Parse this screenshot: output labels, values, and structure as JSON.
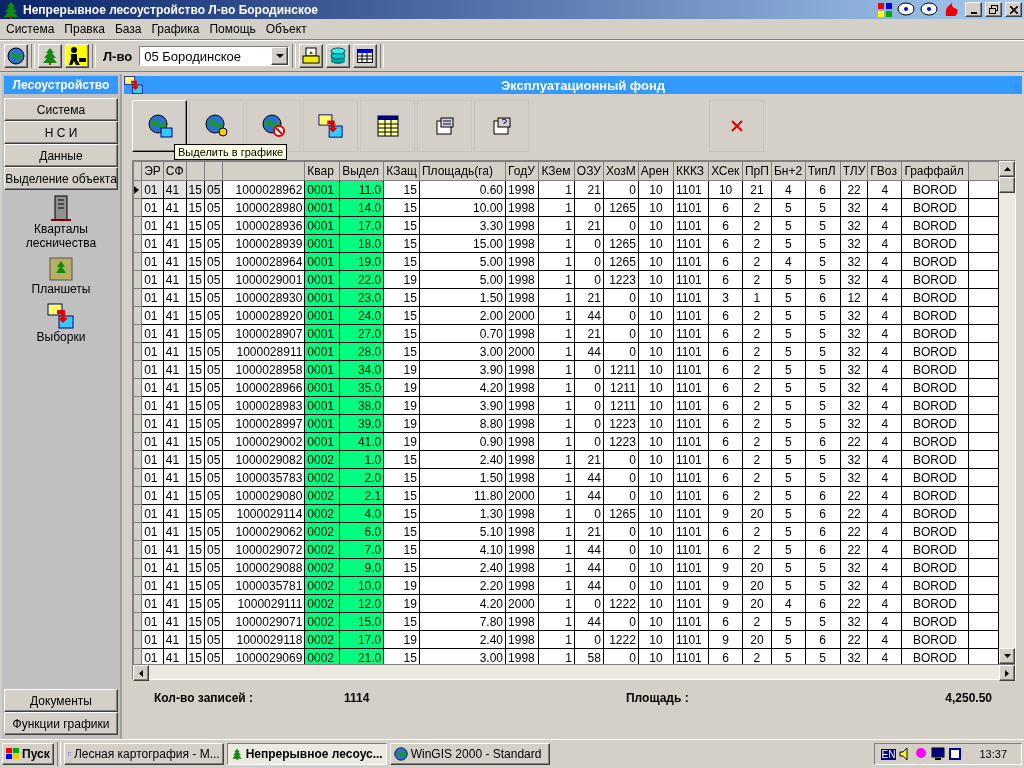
{
  "window": {
    "title": "Непрерывное лесоустройство  Л-во Бородинское"
  },
  "menu": [
    "Система",
    "Правка",
    "База",
    "Графика",
    "Помощь",
    "Объект"
  ],
  "toolbar": {
    "label": "Л-во",
    "select_value": "05 Бородинское"
  },
  "sidebar": {
    "title": "Лесоустройство",
    "buttons": [
      "Система",
      "Н С И",
      "Данные",
      "Выделение объекта"
    ],
    "items": [
      {
        "kind": "tower",
        "label": "Кварталы лесничества"
      },
      {
        "kind": "map",
        "label": "Планшеты"
      },
      {
        "kind": "tables",
        "label": "Выборки"
      }
    ],
    "bottom_buttons": [
      "Документы",
      "Функции графики"
    ]
  },
  "panel": {
    "title": "Эксплуатационный фонд",
    "tools": [
      {
        "kind": "globe-table",
        "pressed": true
      },
      {
        "kind": "globe-pin",
        "pressed": false
      },
      {
        "kind": "globe-ban",
        "pressed": false
      },
      {
        "kind": "tables",
        "pressed": false
      },
      {
        "kind": "grid",
        "pressed": false
      },
      {
        "kind": "form",
        "pressed": false
      },
      {
        "kind": "form-help",
        "pressed": false
      },
      {
        "kind": "close",
        "pressed": false
      }
    ],
    "tooltip": "Выделить в графике",
    "table": {
      "columns": [
        {
          "label": "ЭР",
          "highlighted": false
        },
        {
          "label": "СФ",
          "highlighted": false
        },
        {
          "highlighted": false
        },
        {
          "highlighted": false
        },
        {
          "highlighted": false
        },
        {
          "label": "Квар",
          "highlighted": true
        },
        {
          "label": "Выдел",
          "highlighted": true
        },
        {
          "label": "КЗащ",
          "highlighted": false
        },
        {
          "label": "Площадь(га)",
          "highlighted": false
        },
        {
          "label": "ГодУ",
          "highlighted": false
        },
        {
          "label": "КЗем",
          "highlighted": false
        },
        {
          "label": "ОЗУ",
          "highlighted": false
        },
        {
          "label": "ХозМ",
          "highlighted": false
        },
        {
          "label": "Арен",
          "highlighted": false
        },
        {
          "label": "КККЗ",
          "highlighted": false
        },
        {
          "label": "ХСек",
          "highlighted": false
        },
        {
          "label": "ПрП",
          "highlighted": false
        },
        {
          "label": "Бн+2",
          "highlighted": false
        },
        {
          "label": "ТипЛ",
          "highlighted": false
        },
        {
          "label": "ТЛУ",
          "highlighted": false
        },
        {
          "label": "ГВоз",
          "highlighted": false
        },
        {
          "label": "Граффайл",
          "highlighted": false
        }
      ],
      "rows": [
        {
          "selected": true,
          "cells": [
            "01",
            "41",
            "15",
            "05",
            "1000028962",
            "0001",
            "11.0",
            "15",
            "0.60",
            "1998",
            "1",
            "21",
            "0",
            "10",
            "1101",
            "10",
            "21",
            "4",
            "6",
            "22",
            "4",
            "BOROD"
          ]
        },
        {
          "selected": false,
          "cells": [
            "01",
            "41",
            "15",
            "05",
            "1000028980",
            "0001",
            "14.0",
            "15",
            "10.00",
            "1998",
            "1",
            "0",
            "1265",
            "10",
            "1101",
            "6",
            "2",
            "5",
            "5",
            "32",
            "4",
            "BOROD"
          ]
        },
        {
          "selected": false,
          "cells": [
            "01",
            "41",
            "15",
            "05",
            "1000028936",
            "0001",
            "17.0",
            "15",
            "3.30",
            "1998",
            "1",
            "21",
            "0",
            "10",
            "1101",
            "6",
            "2",
            "5",
            "5",
            "32",
            "4",
            "BOROD"
          ]
        },
        {
          "selected": false,
          "cells": [
            "01",
            "41",
            "15",
            "05",
            "1000028939",
            "0001",
            "18.0",
            "15",
            "15.00",
            "1998",
            "1",
            "0",
            "1265",
            "10",
            "1101",
            "6",
            "2",
            "5",
            "5",
            "32",
            "4",
            "BOROD"
          ]
        },
        {
          "selected": false,
          "cells": [
            "01",
            "41",
            "15",
            "05",
            "1000028964",
            "0001",
            "19.0",
            "15",
            "5.00",
            "1998",
            "1",
            "0",
            "1265",
            "10",
            "1101",
            "6",
            "2",
            "4",
            "5",
            "32",
            "4",
            "BOROD"
          ]
        },
        {
          "selected": false,
          "cells": [
            "01",
            "41",
            "15",
            "05",
            "1000029001",
            "0001",
            "22.0",
            "19",
            "5.00",
            "1998",
            "1",
            "0",
            "1223",
            "10",
            "1101",
            "6",
            "2",
            "5",
            "5",
            "32",
            "4",
            "BOROD"
          ]
        },
        {
          "selected": false,
          "cells": [
            "01",
            "41",
            "15",
            "05",
            "1000028930",
            "0001",
            "23.0",
            "15",
            "1.50",
            "1998",
            "1",
            "21",
            "0",
            "10",
            "1101",
            "3",
            "1",
            "5",
            "6",
            "12",
            "4",
            "BOROD"
          ]
        },
        {
          "selected": false,
          "cells": [
            "01",
            "41",
            "15",
            "05",
            "1000028920",
            "0001",
            "24.0",
            "15",
            "2.00",
            "2000",
            "1",
            "44",
            "0",
            "10",
            "1101",
            "6",
            "2",
            "5",
            "5",
            "32",
            "4",
            "BOROD"
          ]
        },
        {
          "selected": false,
          "cells": [
            "01",
            "41",
            "15",
            "05",
            "1000028907",
            "0001",
            "27.0",
            "15",
            "0.70",
            "1998",
            "1",
            "21",
            "0",
            "10",
            "1101",
            "6",
            "2",
            "5",
            "5",
            "32",
            "4",
            "BOROD"
          ]
        },
        {
          "selected": false,
          "cells": [
            "01",
            "41",
            "15",
            "05",
            "1000028911",
            "0001",
            "28.0",
            "15",
            "3.00",
            "2000",
            "1",
            "44",
            "0",
            "10",
            "1101",
            "6",
            "2",
            "5",
            "5",
            "32",
            "4",
            "BOROD"
          ]
        },
        {
          "selected": false,
          "cells": [
            "01",
            "41",
            "15",
            "05",
            "1000028958",
            "0001",
            "34.0",
            "19",
            "3.90",
            "1998",
            "1",
            "0",
            "1211",
            "10",
            "1101",
            "6",
            "2",
            "5",
            "5",
            "32",
            "4",
            "BOROD"
          ]
        },
        {
          "selected": false,
          "cells": [
            "01",
            "41",
            "15",
            "05",
            "1000028966",
            "0001",
            "35.0",
            "19",
            "4.20",
            "1998",
            "1",
            "0",
            "1211",
            "10",
            "1101",
            "6",
            "2",
            "5",
            "5",
            "32",
            "4",
            "BOROD"
          ]
        },
        {
          "selected": false,
          "cells": [
            "01",
            "41",
            "15",
            "05",
            "1000028983",
            "0001",
            "38.0",
            "19",
            "3.90",
            "1998",
            "1",
            "0",
            "1211",
            "10",
            "1101",
            "6",
            "2",
            "5",
            "5",
            "32",
            "4",
            "BOROD"
          ]
        },
        {
          "selected": false,
          "cells": [
            "01",
            "41",
            "15",
            "05",
            "1000028997",
            "0001",
            "39.0",
            "19",
            "8.80",
            "1998",
            "1",
            "0",
            "1223",
            "10",
            "1101",
            "6",
            "2",
            "5",
            "5",
            "32",
            "4",
            "BOROD"
          ]
        },
        {
          "selected": false,
          "cells": [
            "01",
            "41",
            "15",
            "05",
            "1000029002",
            "0001",
            "41.0",
            "19",
            "0.90",
            "1998",
            "1",
            "0",
            "1223",
            "10",
            "1101",
            "6",
            "2",
            "5",
            "6",
            "22",
            "4",
            "BOROD"
          ]
        },
        {
          "selected": false,
          "cells": [
            "01",
            "41",
            "15",
            "05",
            "1000029082",
            "0002",
            "1.0",
            "15",
            "2.40",
            "1998",
            "1",
            "21",
            "0",
            "10",
            "1101",
            "6",
            "2",
            "5",
            "5",
            "32",
            "4",
            "BOROD"
          ]
        },
        {
          "selected": false,
          "cells": [
            "01",
            "41",
            "15",
            "05",
            "1000035783",
            "0002",
            "2.0",
            "15",
            "1.50",
            "1998",
            "1",
            "44",
            "0",
            "10",
            "1101",
            "6",
            "2",
            "5",
            "5",
            "32",
            "4",
            "BOROD"
          ]
        },
        {
          "selected": false,
          "cells": [
            "01",
            "41",
            "15",
            "05",
            "1000029080",
            "0002",
            "2.1",
            "15",
            "11.80",
            "2000",
            "1",
            "44",
            "0",
            "10",
            "1101",
            "6",
            "2",
            "5",
            "6",
            "22",
            "4",
            "BOROD"
          ]
        },
        {
          "selected": false,
          "cells": [
            "01",
            "41",
            "15",
            "05",
            "1000029114",
            "0002",
            "4.0",
            "15",
            "1.30",
            "1998",
            "1",
            "0",
            "1265",
            "10",
            "1101",
            "9",
            "20",
            "5",
            "6",
            "22",
            "4",
            "BOROD"
          ]
        },
        {
          "selected": false,
          "cells": [
            "01",
            "41",
            "15",
            "05",
            "1000029062",
            "0002",
            "6.0",
            "15",
            "5.10",
            "1998",
            "1",
            "21",
            "0",
            "10",
            "1101",
            "6",
            "2",
            "5",
            "6",
            "22",
            "4",
            "BOROD"
          ]
        },
        {
          "selected": false,
          "cells": [
            "01",
            "41",
            "15",
            "05",
            "1000029072",
            "0002",
            "7.0",
            "15",
            "4.10",
            "1998",
            "1",
            "44",
            "0",
            "10",
            "1101",
            "6",
            "2",
            "5",
            "6",
            "22",
            "4",
            "BOROD"
          ]
        },
        {
          "selected": false,
          "cells": [
            "01",
            "41",
            "15",
            "05",
            "1000029088",
            "0002",
            "9.0",
            "15",
            "2.40",
            "1998",
            "1",
            "44",
            "0",
            "10",
            "1101",
            "9",
            "20",
            "5",
            "5",
            "32",
            "4",
            "BOROD"
          ]
        },
        {
          "selected": false,
          "cells": [
            "01",
            "41",
            "15",
            "05",
            "1000035781",
            "0002",
            "10.0",
            "19",
            "2.20",
            "1998",
            "1",
            "44",
            "0",
            "10",
            "1101",
            "9",
            "20",
            "5",
            "5",
            "32",
            "4",
            "BOROD"
          ]
        },
        {
          "selected": false,
          "cells": [
            "01",
            "41",
            "15",
            "05",
            "1000029111",
            "0002",
            "12.0",
            "19",
            "4.20",
            "2000",
            "1",
            "0",
            "1222",
            "10",
            "1101",
            "9",
            "20",
            "4",
            "6",
            "22",
            "4",
            "BOROD"
          ]
        },
        {
          "selected": false,
          "cells": [
            "01",
            "41",
            "15",
            "05",
            "1000029071",
            "0002",
            "15.0",
            "15",
            "7.80",
            "1998",
            "1",
            "44",
            "0",
            "10",
            "1101",
            "6",
            "2",
            "5",
            "5",
            "32",
            "4",
            "BOROD"
          ]
        },
        {
          "selected": false,
          "cells": [
            "01",
            "41",
            "15",
            "05",
            "1000029118",
            "0002",
            "17.0",
            "19",
            "2.40",
            "1998",
            "1",
            "0",
            "1222",
            "10",
            "1101",
            "9",
            "20",
            "5",
            "6",
            "22",
            "4",
            "BOROD"
          ]
        },
        {
          "selected": false,
          "cells": [
            "01",
            "41",
            "15",
            "05",
            "1000029069",
            "0002",
            "21.0",
            "15",
            "3.00",
            "1998",
            "1",
            "58",
            "0",
            "10",
            "1101",
            "6",
            "2",
            "5",
            "5",
            "32",
            "4",
            "BOROD"
          ]
        }
      ]
    },
    "status": {
      "count_label": "Кол-во записей :",
      "count": "1114",
      "area_label": "Площадь :",
      "area": "4,250.50"
    }
  },
  "taskbar": {
    "start": "Пуск",
    "tasks": [
      {
        "label": "Лесная картография - М...",
        "selected": false
      },
      {
        "label": "Непрерывное лесоус...",
        "selected": true
      },
      {
        "label": "WinGIS 2000 - Standard",
        "selected": false
      }
    ],
    "tray_lang": "EN",
    "clock": "13:37"
  }
}
